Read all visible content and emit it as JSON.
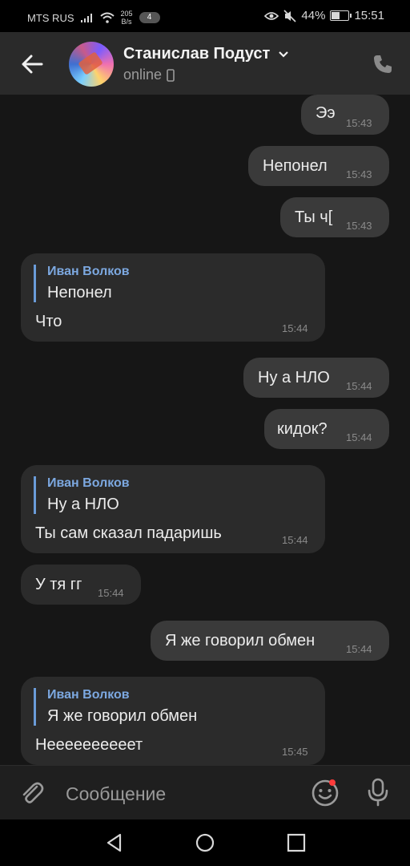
{
  "status_bar": {
    "carrier": "MTS RUS",
    "speed_value": "205",
    "speed_unit": "B/s",
    "sim_badge": "4",
    "battery": "44%",
    "battery_level": 0.44,
    "time": "15:51"
  },
  "header": {
    "contact_name": "Станислав Подуст",
    "status": "online"
  },
  "messages": [
    {
      "text": "Ээ",
      "time": "15:43"
    },
    {
      "text": "Непонел",
      "time": "15:43"
    },
    {
      "text": "Ты ч[",
      "time": "15:43"
    },
    {
      "reply_author": "Иван Волков",
      "reply_text": "Непонел",
      "text": "Что",
      "time": "15:44"
    },
    {
      "text": "Ну а НЛО",
      "time": "15:44"
    },
    {
      "text": "кидок?",
      "time": "15:44"
    },
    {
      "reply_author": "Иван Волков",
      "reply_text": "Ну а НЛО",
      "text": "Ты сам сказал падаришь",
      "time": "15:44"
    },
    {
      "text": "У тя гг",
      "time": "15:44"
    },
    {
      "text": "Я же говорил обмен",
      "time": "15:44"
    },
    {
      "reply_author": "Иван Волков",
      "reply_text": "Я же говорил обмен",
      "text": "Неееееееееет",
      "time": "15:45"
    }
  ],
  "composer": {
    "placeholder": "Сообщение"
  },
  "colors": {
    "background": "#161616",
    "outgoing_bubble": "#3a3a3a",
    "incoming_bubble": "#2b2b2b",
    "reply_accent": "#7ca8e0",
    "notification_dot": "#ff3b3b"
  }
}
